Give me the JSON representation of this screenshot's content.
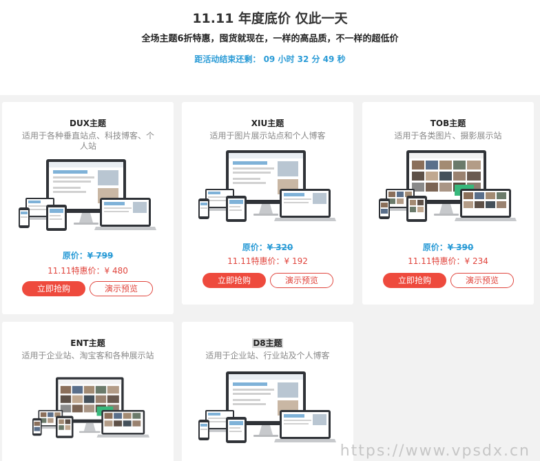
{
  "hero": {
    "title": "11.11 年度底价  仅此一天",
    "subtitle": "全场主题6折特惠，囤货就现在，一样的高品质，不一样的超低价",
    "countdown": "距活动结束还剩： 09 小时 32 分 49 秒"
  },
  "cards": [
    {
      "name": "DUX主题",
      "desc": "适用于各种垂直站点、科技博客、个人站",
      "orig_label": "原价：",
      "orig_price": "¥ 799",
      "sale": "11.11特惠价：¥ 480",
      "buy": "立即抢购",
      "demo": "演示预览"
    },
    {
      "name": "XIU主题",
      "desc": "适用于图片展示站点和个人博客",
      "orig_label": "原价：",
      "orig_price": "¥ 320",
      "sale": "11.11特惠价：¥ 192",
      "buy": "立即抢购",
      "demo": "演示预览"
    },
    {
      "name": "TOB主题",
      "desc": "适用于各类图片、摄影展示站",
      "orig_label": "原价：",
      "orig_price": "¥ 390",
      "sale": "11.11特惠价：¥ 234",
      "buy": "立即抢购",
      "demo": "演示预览"
    },
    {
      "name": "ENT主题",
      "desc": "适用于企业站、淘宝客和各种展示站"
    },
    {
      "name": "D8主题",
      "desc": "适用于企业站、行业站及个人博客"
    }
  ],
  "watermark": "https://www.vpsdx.cn",
  "colors": {
    "accent": "#ee4a3d",
    "link": "#2a9bd6",
    "bg": "#f2f2f2"
  }
}
